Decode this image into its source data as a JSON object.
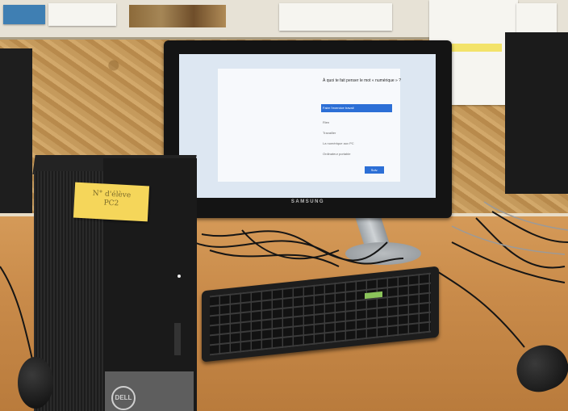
{
  "scene": {
    "description_free": true
  },
  "monitor": {
    "brand": "SAMSUNG",
    "dialog": {
      "question": "À quoi te fait penser le mot « numérique » ?",
      "options": [
        "Faire l'exercice travail",
        "Rien",
        "Travailler",
        "La numérique aux PC",
        "Ordinateur portable"
      ],
      "next_button": "Suiv."
    }
  },
  "sticky_note": {
    "text_line1": "N° d'élève",
    "text_line2": "PC2"
  },
  "tower": {
    "logo": "DELL"
  },
  "colors": {
    "screen_background": "#dde7f2",
    "selection_blue": "#2c6fd6",
    "sticky_yellow": "#f5d65a",
    "desk_wood": "#c98b4a"
  }
}
